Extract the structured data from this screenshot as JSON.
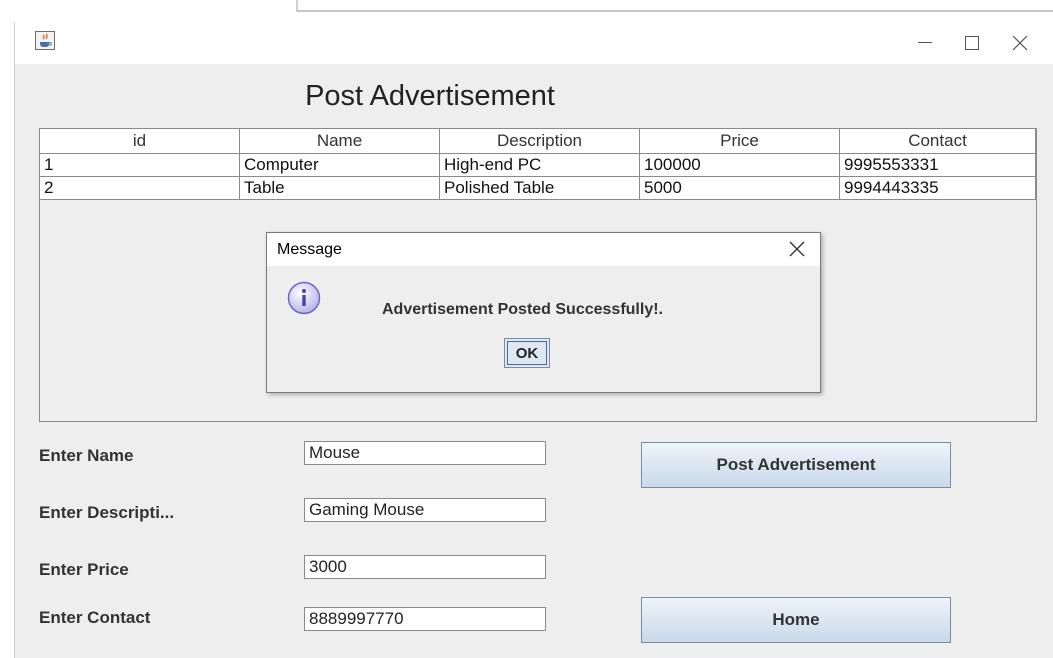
{
  "heading": "Post Advertisement",
  "table": {
    "columns": [
      "id",
      "Name",
      "Description",
      "Price",
      "Contact"
    ],
    "rows": [
      [
        "1",
        "Computer",
        "High-end PC",
        "100000",
        "9995553331"
      ],
      [
        "2",
        "Table",
        "Polished Table",
        "5000",
        "9994443335"
      ]
    ]
  },
  "dialog": {
    "title": "Message",
    "message": "Advertisement Posted Successfully!.",
    "ok_label": "OK",
    "icon": "info-icon"
  },
  "form": {
    "name_label": "Enter Name",
    "name_value": "Mouse",
    "description_label": "Enter Descripti...",
    "description_value": "Gaming Mouse",
    "price_label": "Enter Price",
    "price_value": "3000",
    "contact_label": "Enter Contact",
    "contact_value": "8889997770"
  },
  "buttons": {
    "post_label": "Post Advertisement",
    "home_label": "Home"
  },
  "icons": {
    "app": "java-cup-icon",
    "minimize": "minimize-icon",
    "maximize": "maximize-icon",
    "close": "close-icon"
  }
}
